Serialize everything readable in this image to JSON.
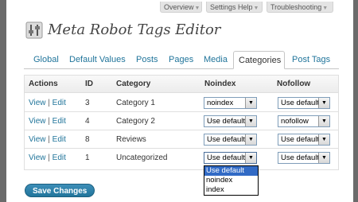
{
  "help_tabs": [
    {
      "label": "Overview"
    },
    {
      "label": "Settings Help"
    },
    {
      "label": "Troubleshooting"
    }
  ],
  "page": {
    "title": "Meta Robot Tags Editor"
  },
  "tabs": [
    {
      "label": "Global",
      "active": false
    },
    {
      "label": "Default Values",
      "active": false
    },
    {
      "label": "Posts",
      "active": false
    },
    {
      "label": "Pages",
      "active": false
    },
    {
      "label": "Media",
      "active": false
    },
    {
      "label": "Categories",
      "active": true
    },
    {
      "label": "Post Tags",
      "active": false
    }
  ],
  "table": {
    "headers": {
      "actions": "Actions",
      "id": "ID",
      "category": "Category",
      "noindex": "Noindex",
      "nofollow": "Nofollow"
    },
    "rows": [
      {
        "view": "View",
        "sep": "|",
        "edit": "Edit",
        "id": "3",
        "category": "Category 1",
        "noindex": "noindex",
        "nofollow": "Use default"
      },
      {
        "view": "View",
        "sep": "|",
        "edit": "Edit",
        "id": "4",
        "category": "Category 2",
        "noindex": "Use default",
        "nofollow": "nofollow"
      },
      {
        "view": "View",
        "sep": "|",
        "edit": "Edit",
        "id": "8",
        "category": "Reviews",
        "noindex": "Use default",
        "nofollow": "Use default"
      },
      {
        "view": "View",
        "sep": "|",
        "edit": "Edit",
        "id": "1",
        "category": "Uncategorized",
        "noindex": "Use default",
        "nofollow": "Use default"
      }
    ]
  },
  "dropdown": {
    "options": [
      "Use default",
      "noindex",
      "index"
    ],
    "selected_index": 0
  },
  "save_button": "Save Changes",
  "colors": {
    "link": "#21759b",
    "button": "#21759b",
    "dropdown_highlight": "#316ac5"
  }
}
